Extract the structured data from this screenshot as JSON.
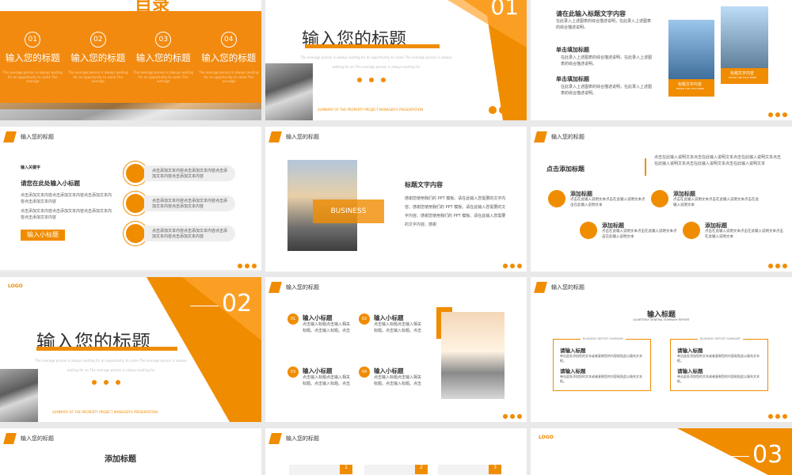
{
  "s1": {
    "title_top": "目录",
    "items": [
      {
        "num": "01",
        "label": "输入您的标题",
        "desc": "The average person is always waiting for an opportunity to come The average"
      },
      {
        "num": "02",
        "label": "输入您的标题",
        "desc": "The average person is always waiting for an opportunity to come The average"
      },
      {
        "num": "03",
        "label": "输入您的标题",
        "desc": "The average person is always waiting for an opportunity to come The average"
      },
      {
        "num": "04",
        "label": "输入您的标题",
        "desc": "The average person is always waiting for an opportunity to come The average"
      }
    ]
  },
  "s2": {
    "title": "输入您的标题",
    "num": "01",
    "sub1": "The average person is always waiting for an opportunity to come The average person is always",
    "sub2": "waiting for an The average person is always waiting for",
    "summary": "SUMMARY OF THE PROPERTY PROJECT MANAGER'S PRESENTATION"
  },
  "s3": {
    "heading": "请在此输入标题文字内容",
    "intro": "在此录入上述图表的综合描述说明，在此录入上述图表的综合描述说明。",
    "b1": "单击填加标题",
    "b1d": "在此录入上述图表的综合描述说明，在此录入上述图表的综合描述说明。",
    "b2": "单击填加标题",
    "b2d": "在此录入上述图表的综合描述说明，在此录入上述图表的综合描述说明。",
    "cap1": "标题文字内容",
    "cap1s": "ENTER THE TITLE HERE",
    "cap2": "标题文字内容",
    "cap2s": "ENTER THE TITLE HERE"
  },
  "s4": {
    "hdr": "输入您的标题",
    "kw": "输入关键字",
    "title": "请您在此处输入小标题",
    "p": "点击添加文本内容点击添加文本内容点击添加文本内容点击添加文本内容",
    "p2": "点击添加文本内容点击添加文本内容点击添加文本内容点击添加文本内容",
    "tag": "输入小标题",
    "rows": [
      "点击添加文本内容点击添加文本内容点击添加文本内容点击添加文本内容",
      "点击添加文本内容点击添加文本内容点击添加文本内容点击添加文本内容",
      "点击添加文本内容点击添加文本内容点击添加文本内容点击添加文本内容"
    ]
  },
  "s5": {
    "hdr": "输入您的标题",
    "overlay": "BUSINESS",
    "title": "标题文字内容",
    "body": "感谢您使用我们的 PPT 模板。请在此输入您需要的文字内容。感谢您使用我们的 PPT 模板。请在此输入您需要的文字内容。感谢您使用我们的 PPT 模板。请在此输入您需要的文字内容。感谢"
  },
  "s6": {
    "hdr": "输入您的标题",
    "left": "点击添加标题",
    "right": "点击在此输入说明文本点击在此输入说明文本点击在此输入说明文本点击在此输入说明文本点击在此输入说明文本点击在此输入说明文本",
    "items": [
      {
        "t": "添加标题",
        "d": "点击在此输入说明文本点击在此输入说明文本点击在此输入说明文本"
      },
      {
        "t": "添加标题",
        "d": "点击在此输入说明文本点击在此输入说明文本点击在此输入说明文本"
      },
      {
        "t": "添加标题",
        "d": "点击在此输入说明文本点击在此输入说明文本点击在此输入说明文本"
      },
      {
        "t": "添加标题",
        "d": "点击在此输入说明文本点击在此输入说明文本点击在此输入说明文本"
      }
    ]
  },
  "s7": {
    "logo": "LOGO",
    "num": "02",
    "title": "输入您的标题",
    "sub1": "The average person is always waiting for an opportunity to come The average person is always",
    "sub2": "waiting for an The average person is always waiting for",
    "summary": "SUMMARY OF THE PROPERTY PROJECT MANAGER'S PRESENTATION"
  },
  "s8": {
    "hdr": "输入您的标题",
    "items": [
      {
        "n": "01",
        "t": "输入小标题",
        "d": "点击输入标题点击输入相关标题。点击输入标题。点击"
      },
      {
        "n": "02",
        "t": "输入小标题",
        "d": "点击输入标题点击输入相关标题。点击输入标题。点击"
      },
      {
        "n": "03",
        "t": "输入小标题",
        "d": "点击输入标题点击输入相关标题。点击输入标题。点击"
      },
      {
        "n": "04",
        "t": "输入小标题",
        "d": "点击输入标题点击输入相关标题。点击输入标题。点击"
      }
    ]
  },
  "s9": {
    "hdr": "输入您的标题",
    "title": "输入标题",
    "sub": "QUARTERLY GENERAL SUMMARY REPORT",
    "boxes": [
      {
        "cap": "BUSINESS REPORT SUMMARY",
        "t1": "请输入标题",
        "d1": "单击此处添加您的文本或者复制您的内容粘贴此以填充文本框。",
        "t2": "请输入标题",
        "d2": "单击此处添加您的文本或者复制您的内容粘贴此以填充文本框。"
      },
      {
        "cap": "BUSINESS REPORT SUMMARY",
        "t1": "请输入标题",
        "d1": "单击此处添加您的文本或者复制您的内容粘贴此以填充文本框。",
        "t2": "请输入标题",
        "d2": "单击此处添加您的文本或者复制您的内容粘贴此以填充文本框。"
      }
    ]
  },
  "s10": {
    "hdr": "输入您的标题",
    "title": "添加标题"
  },
  "s11": {
    "hdr": "输入您的标题",
    "nums": [
      "1",
      "2",
      "3"
    ]
  },
  "s12": {
    "logo": "LOGO",
    "num": "03"
  }
}
